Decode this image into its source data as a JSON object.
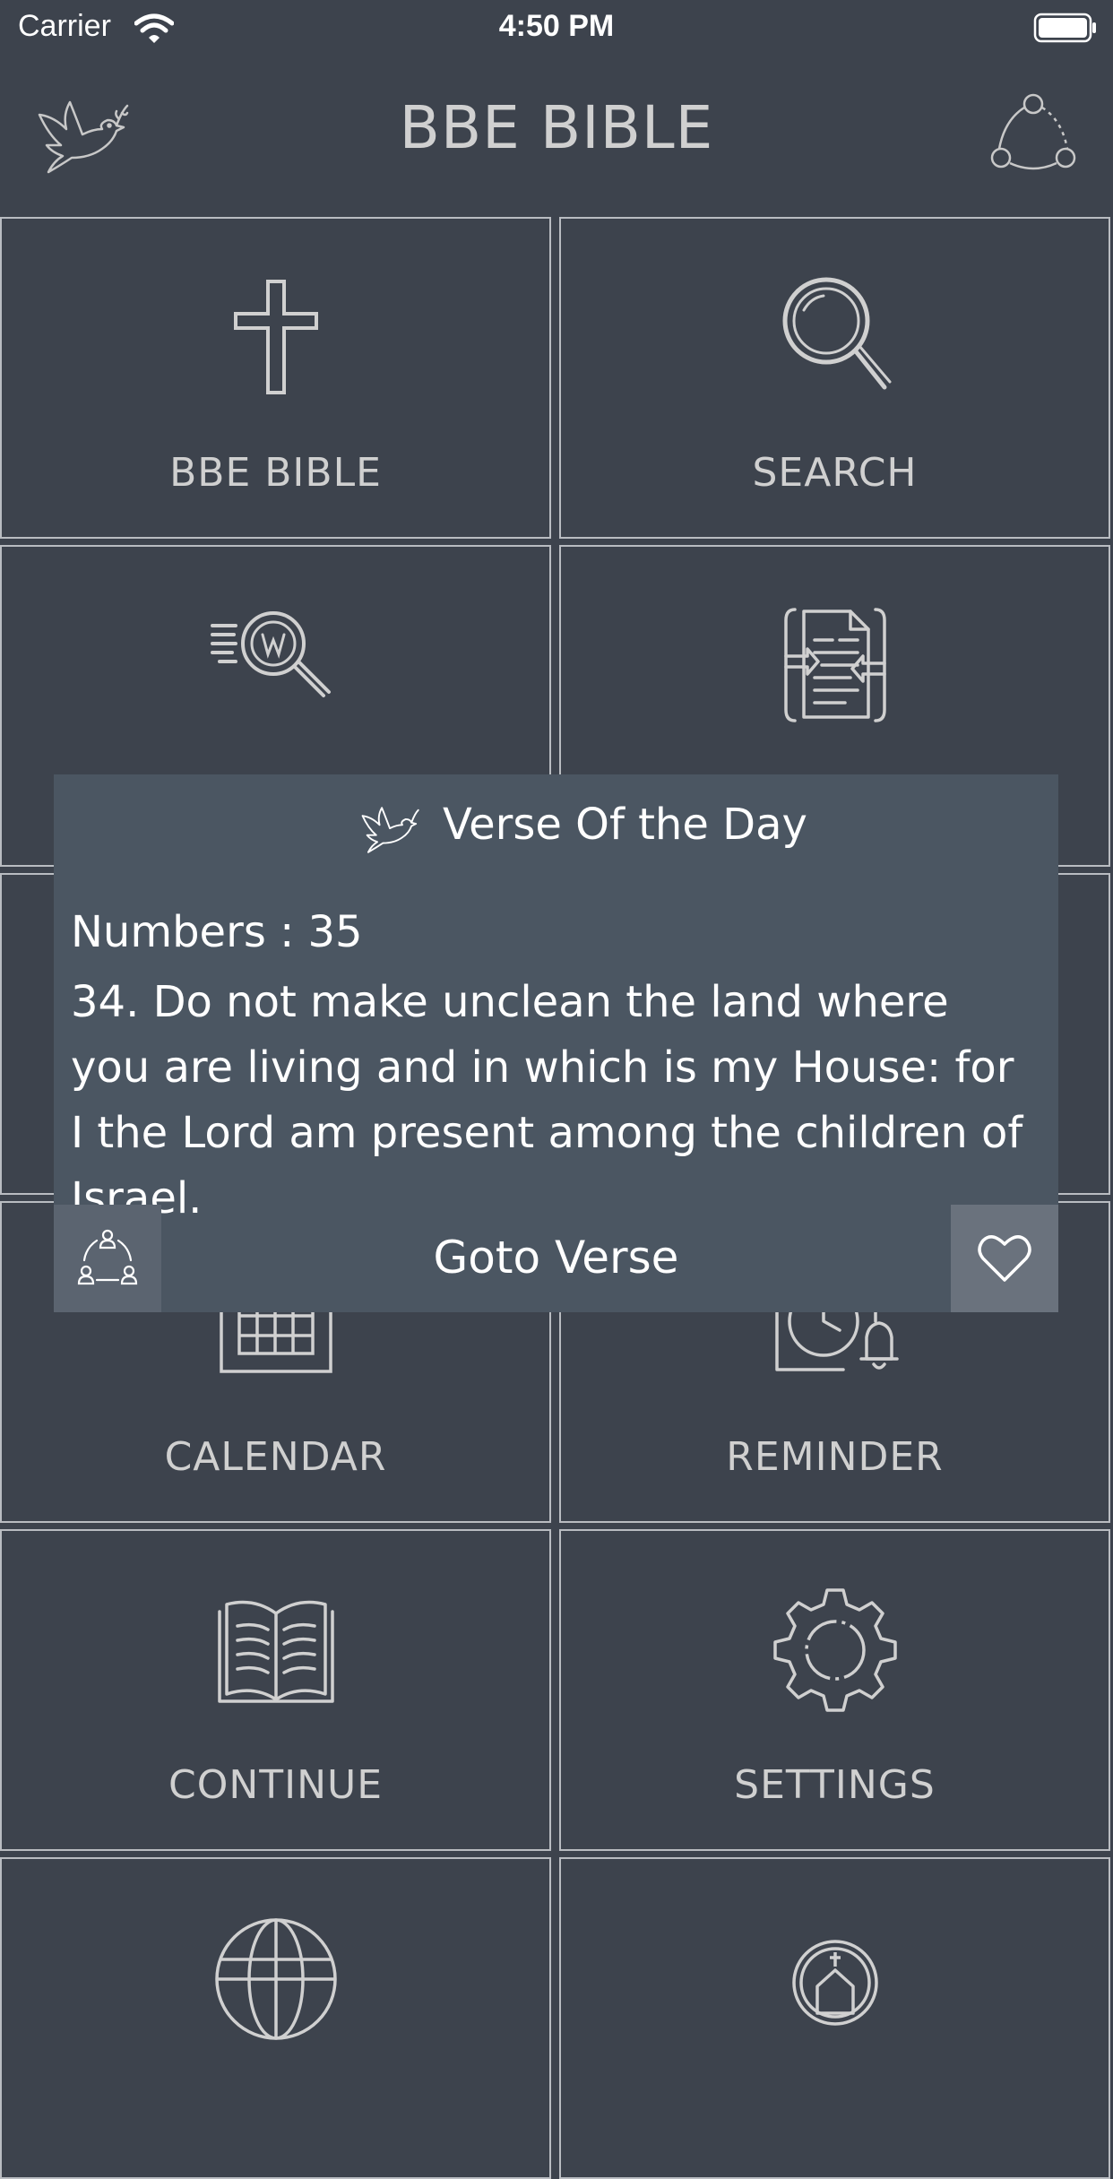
{
  "status_bar": {
    "carrier": "Carrier",
    "time": "4:50 PM",
    "icons": [
      "wifi-icon",
      "battery-icon"
    ]
  },
  "header": {
    "title": "BBE BIBLE",
    "left_icon": "dove-icon",
    "right_icon": "share-icon"
  },
  "tiles": [
    {
      "label": "BBE BIBLE",
      "icon": "cross-icon"
    },
    {
      "label": "SEARCH",
      "icon": "magnifier-icon"
    },
    {
      "label": "",
      "icon": "word-search-icon"
    },
    {
      "label": "",
      "icon": "document-transfer-icon"
    },
    {
      "label": "",
      "icon": ""
    },
    {
      "label": "",
      "icon": ""
    },
    {
      "label": "CALENDAR",
      "icon": "calendar-icon"
    },
    {
      "label": "REMINDER",
      "icon": "reminder-icon"
    },
    {
      "label": "CONTINUE",
      "icon": "open-book-icon"
    },
    {
      "label": "SETTINGS",
      "icon": "gear-icon"
    },
    {
      "label": "",
      "icon": "globe-icon"
    },
    {
      "label": "",
      "icon": "church-icon"
    }
  ],
  "verse_popup": {
    "title": "Verse Of the Day",
    "reference": "Numbers : 35",
    "text": "34. Do not make unclean the land where you are living and in which is my House: for I the Lord am present among the children of Israel.",
    "goto_label": "Goto Verse",
    "share_icon": "people-share-icon",
    "favorite_icon": "heart-icon"
  },
  "colors": {
    "background": "#3d434d",
    "tile_border": "#b9bcc1",
    "popup_background": "#4b5662",
    "text_light": "#d0d0d0"
  }
}
